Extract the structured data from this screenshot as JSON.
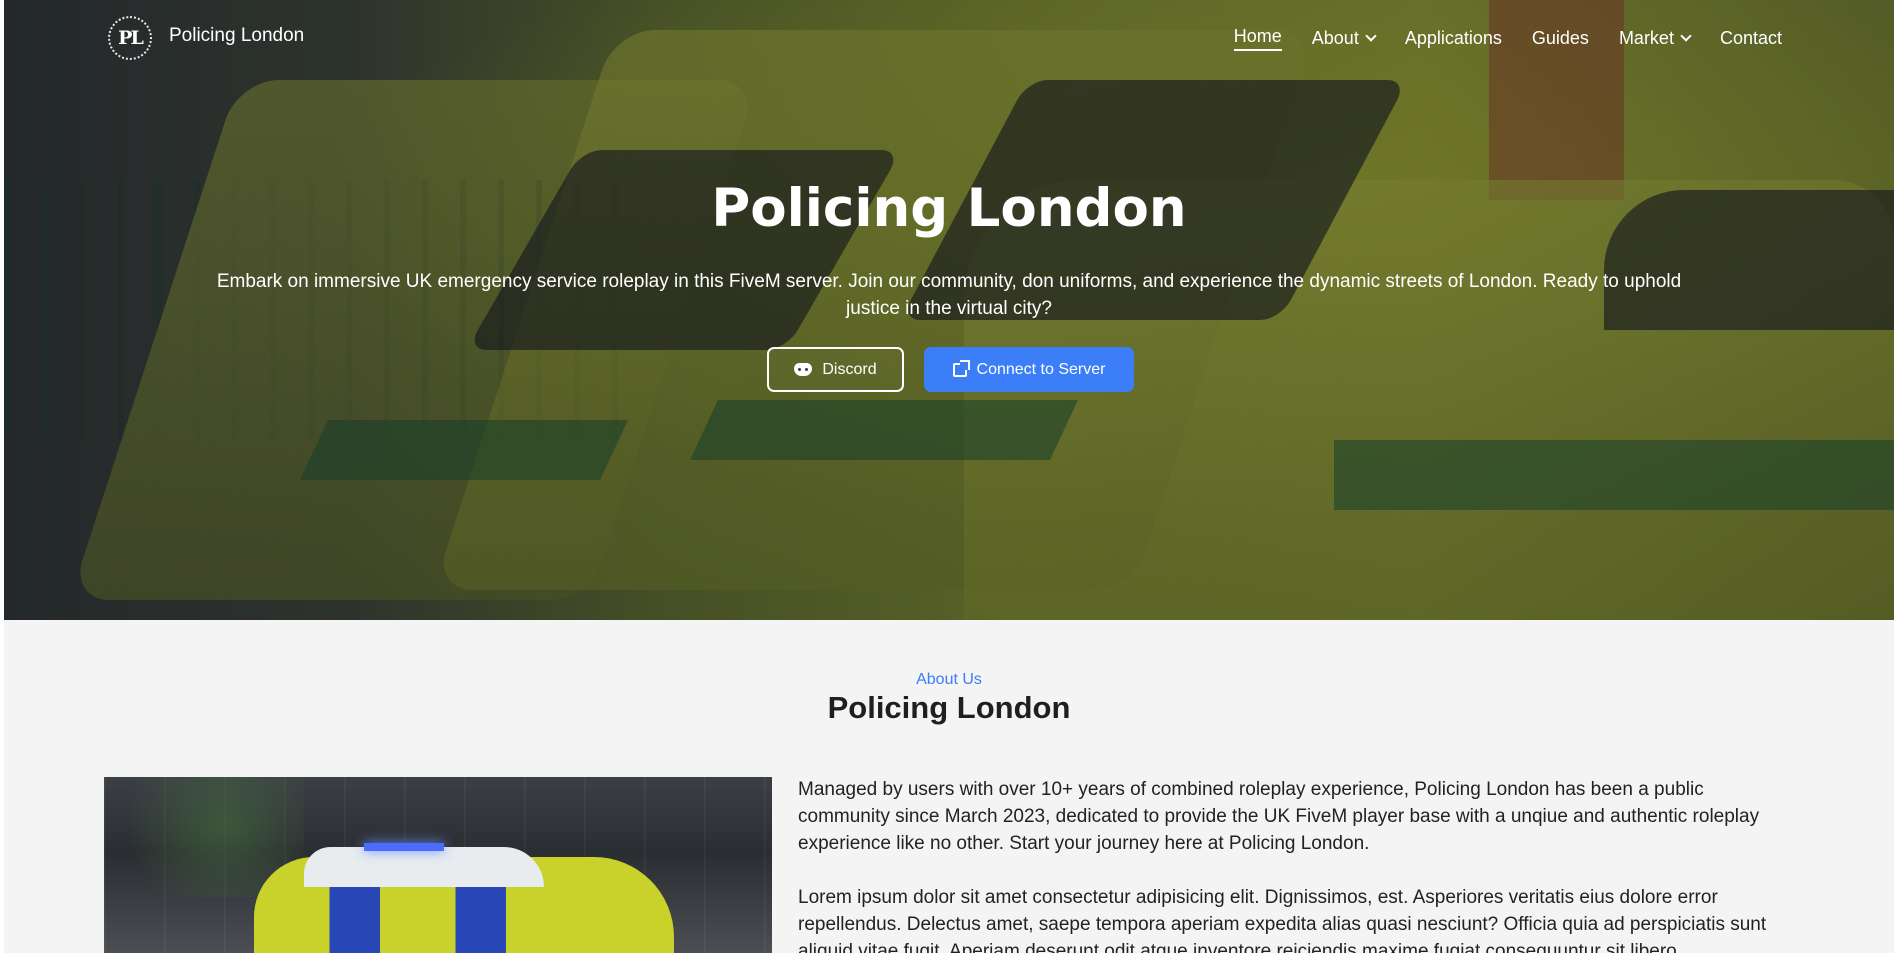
{
  "nav": {
    "logo_text": "PL",
    "brand": "Policing London",
    "items": [
      {
        "label": "Home",
        "active": true,
        "dropdown": false
      },
      {
        "label": "About",
        "active": false,
        "dropdown": true
      },
      {
        "label": "Applications",
        "active": false,
        "dropdown": false
      },
      {
        "label": "Guides",
        "active": false,
        "dropdown": false
      },
      {
        "label": "Market",
        "active": false,
        "dropdown": true
      },
      {
        "label": "Contact",
        "active": false,
        "dropdown": false
      }
    ]
  },
  "hero": {
    "title": "Policing London",
    "subtitle": "Embark on immersive UK emergency service roleplay in this FiveM server. Join our community, don uniforms, and experience the dynamic streets of London. Ready to uphold justice in the virtual city?",
    "buttons": {
      "discord": {
        "label": "Discord",
        "icon": "discord-icon"
      },
      "connect": {
        "label": "Connect to Server",
        "icon": "external-link-icon"
      }
    }
  },
  "about": {
    "eyebrow": "About Us",
    "title": "Policing London",
    "paragraphs": [
      "Managed by users with over 10+ years of combined roleplay experience, Policing London has been a public community since March 2023, dedicated to provide the UK FiveM player base with a unqiue and authentic roleplay experience like no other. Start your journey here at Policing London.",
      "Lorem ipsum dolor sit amet consectetur adipisicing elit. Dignissimos, est. Asperiores veritatis eius dolore error repellendus. Delectus amet, saepe tempora aperiam expedita alias quasi nesciunt? Officia quia ad perspiciatis sunt aliquid vitae fugit. Aperiam deserunt odit atque inventore reiciendis maxime fugiat consequuntur sit libero"
    ]
  },
  "colors": {
    "accent": "#3b7ef7",
    "page_bg": "#f4f4f4",
    "text": "#222222"
  }
}
